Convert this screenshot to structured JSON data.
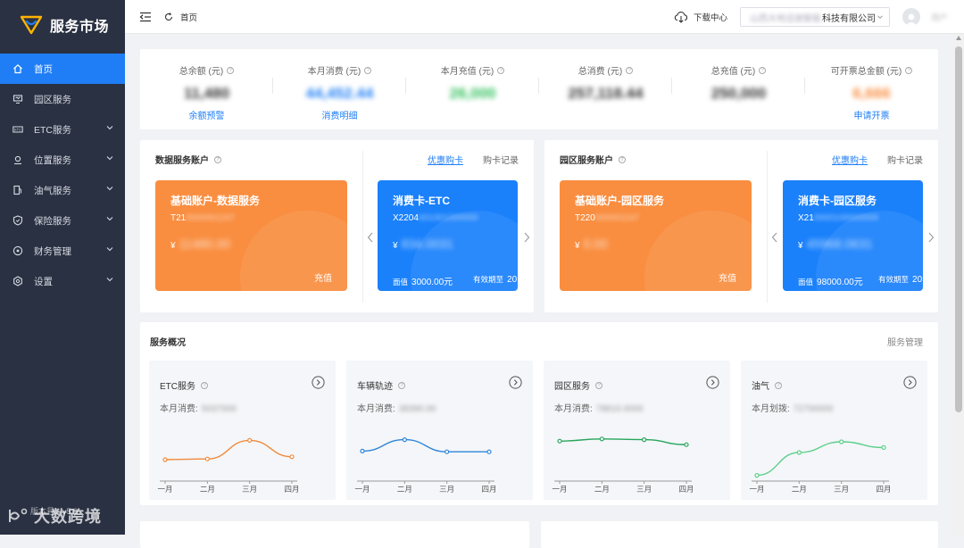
{
  "app": {
    "name": "服务市场"
  },
  "sidebar": {
    "items": [
      {
        "label": "首页",
        "icon": "home-icon"
      },
      {
        "label": "园区服务",
        "icon": "monitor-icon"
      },
      {
        "label": "ETC服务",
        "icon": "etc-icon"
      },
      {
        "label": "位置服务",
        "icon": "location-icon"
      },
      {
        "label": "油气服务",
        "icon": "fuel-icon"
      },
      {
        "label": "保险服务",
        "icon": "shield-icon"
      },
      {
        "label": "财务管理",
        "icon": "finance-icon"
      },
      {
        "label": "设置",
        "icon": "settings-icon"
      }
    ],
    "footer": "版本号：v5.0"
  },
  "topbar": {
    "breadcrumb": "首页",
    "download": "下载中心",
    "company_blurred": "山西大地迅驰智能",
    "company_suffix": "科技有限公司",
    "user": "用户"
  },
  "stats": [
    {
      "label": "总余额 (元)",
      "value": "11,480",
      "link": "余额预警",
      "color": "#333333"
    },
    {
      "label": "本月消费 (元)",
      "value": "44,452.44",
      "link": "消费明细",
      "color": "#1f7ef5"
    },
    {
      "label": "本月充值 (元)",
      "value": "26,000",
      "link": "",
      "color": "#2fbf5a"
    },
    {
      "label": "总消费 (元)",
      "value": "257,118.44",
      "link": "",
      "color": "#333333"
    },
    {
      "label": "总充值 (元)",
      "value": "250,000",
      "link": "",
      "color": "#333333"
    },
    {
      "label": "可开票总金额 (元)",
      "value": "6,666",
      "link": "申请开票",
      "color": "#f98e41"
    }
  ],
  "data_account": {
    "title": "数据服务账户",
    "link_discount": "优惠购卡",
    "link_record": "购卡记录",
    "base_card": {
      "title": "基础账户-数据服务",
      "number": "T21",
      "number_blur": "0000001167",
      "currency": "¥",
      "balance_blur": "11480.00",
      "action": "充值"
    },
    "consume_card": {
      "title": "消费卡-ETC",
      "number": "X2204",
      "number_blur": "001001000000",
      "currency": "¥",
      "balance_blur": "834.0031",
      "face_label": "面值",
      "face_value": "3000.00元",
      "expiry_label": "有效期至",
      "expiry_value": "20"
    }
  },
  "park_account": {
    "title": "园区服务账户",
    "link_discount": "优惠购卡",
    "link_record": "购卡记录",
    "base_card": {
      "title": "基础账户-园区服务",
      "number": "T220",
      "number_blur": "000001167",
      "currency": "¥",
      "balance_blur": "0.00",
      "action": "充值"
    },
    "consume_card": {
      "title": "消费卡-园区服务",
      "number": "X21",
      "number_blur": "0000100000000",
      "currency": "¥",
      "balance_blur": "45968.0631",
      "face_label": "面值",
      "face_value": "98000.00元",
      "expiry_label": "有效期至",
      "expiry_value": "20"
    }
  },
  "services": {
    "title": "服务概况",
    "manage": "服务管理",
    "cards": [
      {
        "name": "ETC服务",
        "stat_label": "本月消费:",
        "stat_blur": "5037000",
        "color": "#f08a3c"
      },
      {
        "name": "车辆轨迹",
        "stat_label": "本月消费:",
        "stat_blur": "38390.00",
        "color": "#2f86d8"
      },
      {
        "name": "园区服务",
        "stat_label": "本月消费:",
        "stat_blur": "78810.0000",
        "color": "#26a65b"
      },
      {
        "name": "油气",
        "stat_label": "本月划拨:",
        "stat_blur": "72700000",
        "color": "#5ccf8a"
      }
    ]
  },
  "chart_data": [
    {
      "type": "line",
      "categories": [
        "一月",
        "二月",
        "三月",
        "四月"
      ],
      "series": [
        {
          "values": [
            30,
            31,
            57,
            34
          ]
        }
      ],
      "ylim": [
        0,
        100
      ]
    },
    {
      "type": "line",
      "categories": [
        "一月",
        "二月",
        "三月",
        "四月"
      ],
      "series": [
        {
          "values": [
            42,
            58,
            41,
            41
          ]
        }
      ],
      "ylim": [
        0,
        100
      ]
    },
    {
      "type": "line",
      "categories": [
        "一月",
        "二月",
        "三月",
        "四月"
      ],
      "series": [
        {
          "values": [
            56,
            59,
            58,
            51
          ]
        }
      ],
      "ylim": [
        0,
        100
      ]
    },
    {
      "type": "line",
      "categories": [
        "一月",
        "二月",
        "三月",
        "四月"
      ],
      "series": [
        {
          "values": [
            8,
            40,
            55,
            47
          ]
        }
      ],
      "ylim": [
        0,
        100
      ]
    }
  ],
  "watermark": "大数跨境"
}
